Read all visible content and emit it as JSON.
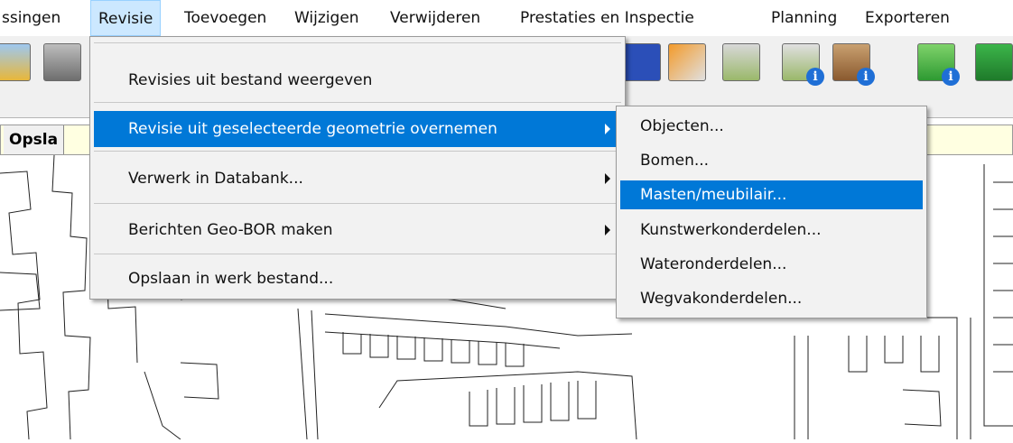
{
  "menubar": {
    "items": [
      "ssingen",
      "Revisie",
      "Toevoegen",
      "Wijzigen",
      "Verwijderen",
      "Prestaties en Inspectie",
      "Planning",
      "Exporteren"
    ]
  },
  "status": {
    "label": "Opsla"
  },
  "toolbar": {
    "icons": [
      "printer-icon",
      "plotter-icon",
      "image-icon",
      "house-icon",
      "map-view-icon",
      "map-info-icon",
      "tools-info-icon",
      "tree-info-icon",
      "forest-icon"
    ]
  },
  "revisie_menu": {
    "items": [
      {
        "label": "Revisies uit bestand weergeven"
      },
      {
        "label": "Revisie uit geselecteerde geometrie overnemen"
      },
      {
        "label": "Verwerk in Databank..."
      },
      {
        "label": "Berichten Geo-BOR maken"
      },
      {
        "label": "Opslaan in werk bestand..."
      }
    ]
  },
  "submenu": {
    "items": [
      "Objecten...",
      "Bomen...",
      "Masten/meubilair...",
      "Kunstwerkonderdelen...",
      "Wateronderdelen...",
      "Wegvakonderdelen..."
    ]
  },
  "colors": {
    "highlight": "#0078d7",
    "active_menu": "#cce8ff",
    "status_bg": "#ffffe1"
  }
}
